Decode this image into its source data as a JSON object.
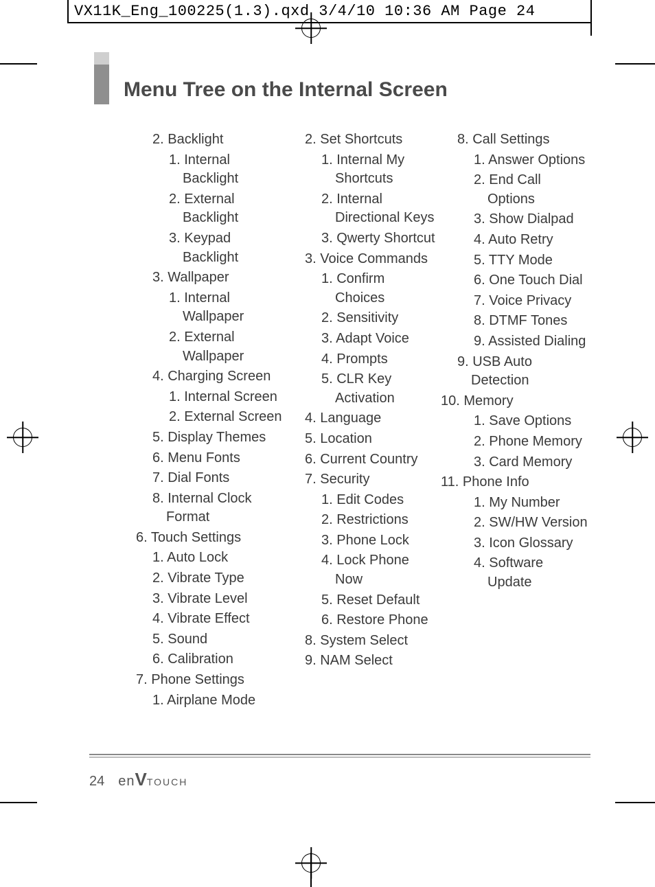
{
  "header": {
    "text": "VX11K_Eng_100225(1.3).qxd  3/4/10  10:36 AM  Page 24"
  },
  "title": "Menu Tree on the Internal Screen",
  "columns": [
    [
      {
        "lvl": 2,
        "t": "2. Backlight"
      },
      {
        "lvl": 3,
        "t": "1. Internal Backlight"
      },
      {
        "lvl": 3,
        "t": "2. External Backlight"
      },
      {
        "lvl": 3,
        "t": "3. Keypad Backlight"
      },
      {
        "lvl": 2,
        "t": "3. Wallpaper"
      },
      {
        "lvl": 3,
        "t": "1. Internal Wallpaper"
      },
      {
        "lvl": 3,
        "t": "2. External Wallpaper"
      },
      {
        "lvl": 2,
        "t": "4. Charging Screen"
      },
      {
        "lvl": 3,
        "t": "1. Internal Screen"
      },
      {
        "lvl": 3,
        "t": "2. External Screen"
      },
      {
        "lvl": 2,
        "t": "5. Display Themes"
      },
      {
        "lvl": 2,
        "t": "6. Menu Fonts"
      },
      {
        "lvl": 2,
        "t": "7. Dial Fonts"
      },
      {
        "lvl": 2,
        "t": "8. Internal Clock Format"
      },
      {
        "lvl": 1,
        "t": "6. Touch Settings"
      },
      {
        "lvl": 2,
        "t": "1. Auto Lock"
      },
      {
        "lvl": 2,
        "t": "2. Vibrate Type"
      },
      {
        "lvl": 2,
        "t": "3. Vibrate Level"
      },
      {
        "lvl": 2,
        "t": "4. Vibrate Effect"
      },
      {
        "lvl": 2,
        "t": "5. Sound"
      },
      {
        "lvl": 2,
        "t": "6. Calibration"
      },
      {
        "lvl": 1,
        "t": "7. Phone Settings"
      },
      {
        "lvl": 2,
        "t": "1. Airplane Mode"
      }
    ],
    [
      {
        "lvl": 2,
        "t": "2. Set Shortcuts"
      },
      {
        "lvl": 3,
        "t": "1. Internal My Shortcuts"
      },
      {
        "lvl": 3,
        "t": "2. Internal Directional Keys"
      },
      {
        "lvl": 3,
        "t": "3. Qwerty Shortcut"
      },
      {
        "lvl": 2,
        "t": "3. Voice Commands"
      },
      {
        "lvl": 3,
        "t": "1. Confirm Choices"
      },
      {
        "lvl": 3,
        "t": "2. Sensitivity"
      },
      {
        "lvl": 3,
        "t": "3. Adapt Voice"
      },
      {
        "lvl": 3,
        "t": "4. Prompts"
      },
      {
        "lvl": 3,
        "t": "5. CLR Key Activation"
      },
      {
        "lvl": 2,
        "t": "4. Language"
      },
      {
        "lvl": 2,
        "t": "5. Location"
      },
      {
        "lvl": 2,
        "t": "6. Current Country"
      },
      {
        "lvl": 2,
        "t": "7. Security"
      },
      {
        "lvl": 3,
        "t": "1. Edit Codes"
      },
      {
        "lvl": 3,
        "t": "2. Restrictions"
      },
      {
        "lvl": 3,
        "t": "3. Phone Lock"
      },
      {
        "lvl": 3,
        "t": "4. Lock Phone Now"
      },
      {
        "lvl": 3,
        "t": "5. Reset Default"
      },
      {
        "lvl": 3,
        "t": "6. Restore Phone"
      },
      {
        "lvl": 2,
        "t": "8. System Select"
      },
      {
        "lvl": 2,
        "t": "9. NAM Select"
      }
    ],
    [
      {
        "lvl": 2,
        "t": "8. Call Settings"
      },
      {
        "lvl": 3,
        "t": "1. Answer Options"
      },
      {
        "lvl": 3,
        "t": "2. End Call Options"
      },
      {
        "lvl": 3,
        "t": "3. Show Dialpad"
      },
      {
        "lvl": 3,
        "t": "4. Auto Retry"
      },
      {
        "lvl": 3,
        "t": "5. TTY Mode"
      },
      {
        "lvl": 3,
        "t": "6. One Touch Dial"
      },
      {
        "lvl": 3,
        "t": "7. Voice Privacy"
      },
      {
        "lvl": 3,
        "t": "8. DTMF Tones"
      },
      {
        "lvl": 3,
        "t": "9. Assisted Dialing"
      },
      {
        "lvl": 2,
        "t": "9. USB Auto Detection"
      },
      {
        "lvl": 1,
        "t": "10. Memory"
      },
      {
        "lvl": 3,
        "t": "1. Save Options"
      },
      {
        "lvl": 3,
        "t": "2. Phone Memory"
      },
      {
        "lvl": 3,
        "t": "3. Card Memory"
      },
      {
        "lvl": 1,
        "t": "11. Phone Info"
      },
      {
        "lvl": 3,
        "t": "1. My Number"
      },
      {
        "lvl": 3,
        "t": "2. SW/HW Version"
      },
      {
        "lvl": 3,
        "t": "3. Icon Glossary"
      },
      {
        "lvl": 3,
        "t": "4. Software Update"
      }
    ]
  ],
  "footer": {
    "page": "24",
    "brand_en": "en",
    "brand_v": "V",
    "brand_touch": "TOUCH"
  }
}
